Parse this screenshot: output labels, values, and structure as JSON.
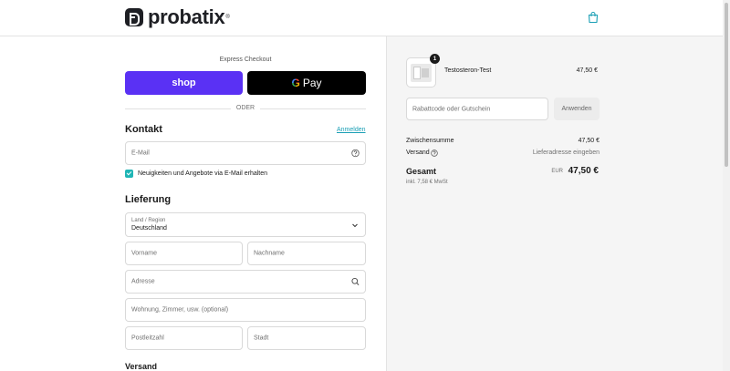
{
  "brand": {
    "name": "probatix",
    "reg": "®"
  },
  "express": {
    "label": "Express Checkout",
    "shop_label": "shop",
    "gpay_g": "G",
    "gpay_label": "Pay",
    "divider_label": "ODER"
  },
  "contact": {
    "title": "Kontakt",
    "login_link": "Anmelden",
    "email_placeholder": "E-Mail",
    "newsletter_label": "Neuigkeiten und Angebote via E-Mail erhalten",
    "newsletter_checked": true
  },
  "delivery": {
    "title": "Lieferung",
    "country_label": "Land / Region",
    "country_value": "Deutschland",
    "first_name_placeholder": "Vorname",
    "last_name_placeholder": "Nachname",
    "address_placeholder": "Adresse",
    "apartment_placeholder": "Wohnung, Zimmer, usw. (optional)",
    "postal_placeholder": "Postleitzahl",
    "city_placeholder": "Stadt"
  },
  "shipping": {
    "title": "Versand"
  },
  "summary": {
    "product": {
      "name": "Testosteron-Test",
      "price": "47,50 €",
      "quantity": "1"
    },
    "discount_placeholder": "Rabattcode oder Gutschein",
    "apply_label": "Anwenden",
    "subtotal_label": "Zwischensumme",
    "subtotal_value": "47,50 €",
    "shipping_label": "Versand",
    "shipping_value": "Lieferadresse eingeben",
    "total_label": "Gesamt",
    "currency": "EUR",
    "total_value": "47,50 €",
    "tax_note": "inkl. 7,58 € MwSt"
  },
  "colors": {
    "shop_pay": "#5a31f4",
    "accent": "#1a9fb5",
    "checkbox": "#1fb5b5",
    "summary_bg": "#f5f5f5"
  },
  "icons": [
    "shopping-bag-icon",
    "question-circle-icon",
    "chevron-down-icon",
    "search-icon",
    "checkmark-icon"
  ]
}
